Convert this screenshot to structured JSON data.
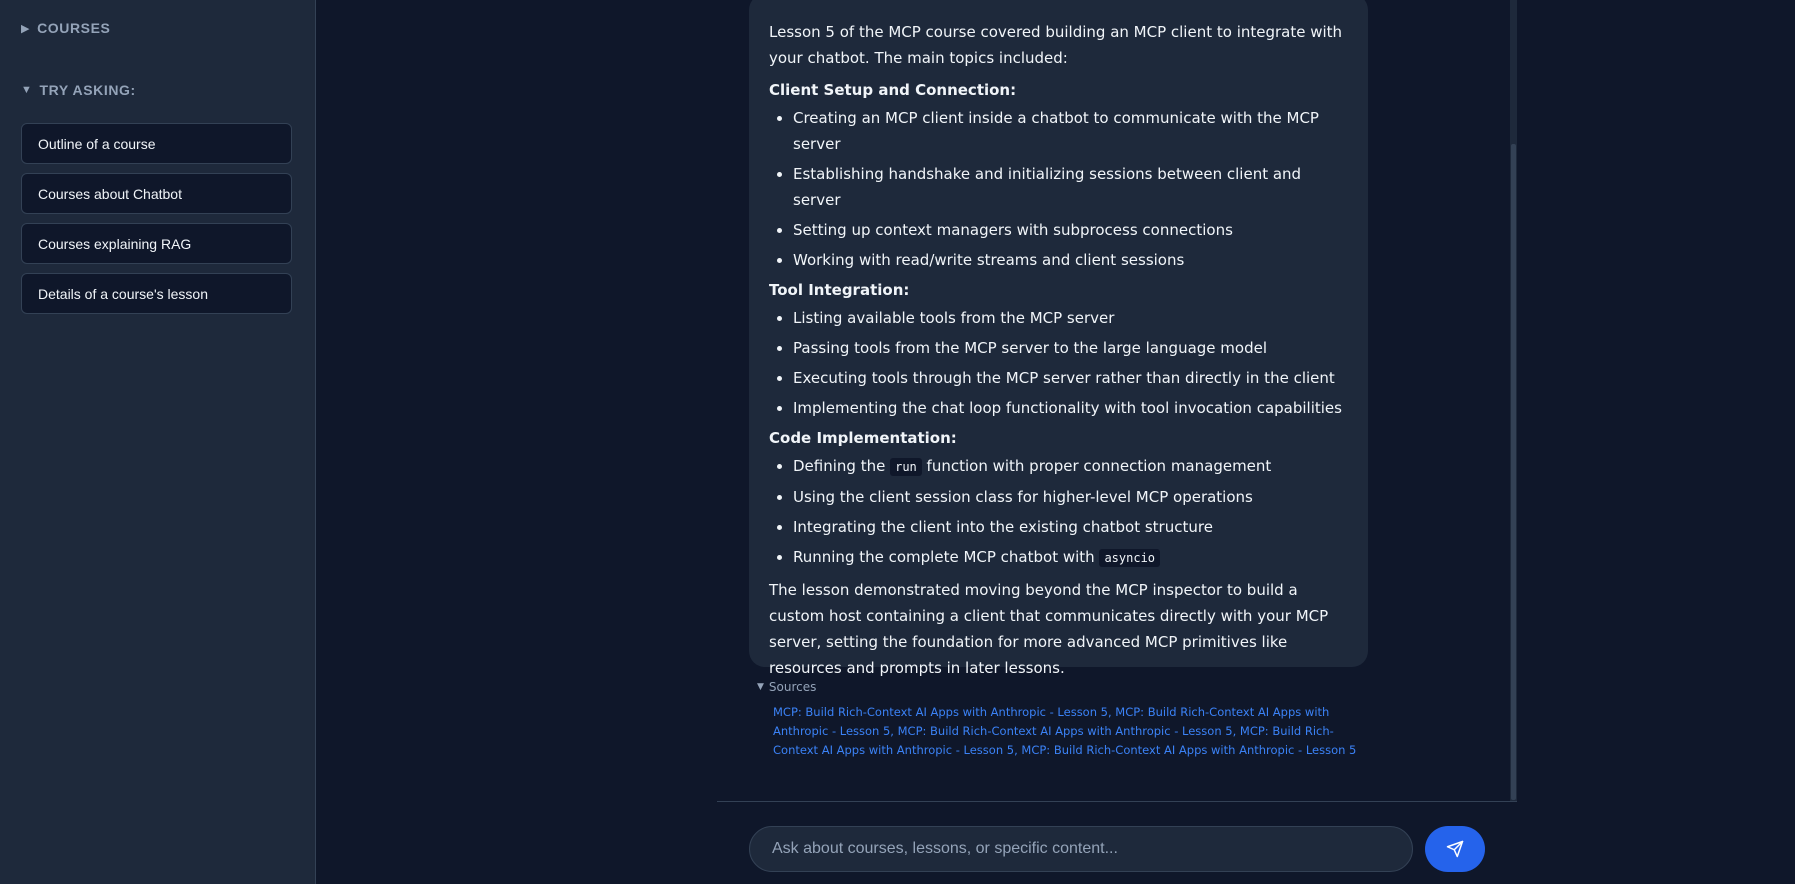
{
  "sidebar": {
    "courses_header": "COURSES",
    "courses_collapsed_glyph": "▶",
    "try_header": "TRY ASKING:",
    "try_expanded_glyph": "▼",
    "suggestions": [
      "Outline of a course",
      "Courses about Chatbot",
      "Courses explaining RAG",
      "Details of a course's lesson"
    ]
  },
  "message": {
    "intro": "Lesson 5 of the MCP course covered building an MCP client to integrate with your chatbot. The main topics included:",
    "sections": [
      {
        "heading": "Client Setup and Connection:",
        "items": [
          "Creating an MCP client inside a chatbot to communicate with the MCP server",
          "Establishing handshake and initializing sessions between client and server",
          "Setting up context managers with subprocess connections",
          "Working with read/write streams and client sessions"
        ]
      },
      {
        "heading": "Tool Integration:",
        "items": [
          "Listing available tools from the MCP server",
          "Passing tools from the MCP server to the large language model",
          "Executing tools through the MCP server rather than directly in the client",
          "Implementing the chat loop functionality with tool invocation capabilities"
        ]
      },
      {
        "heading": "Code Implementation:",
        "items_code": [
          {
            "before": "Defining the ",
            "code": "run",
            "after": " function with proper connection management"
          },
          {
            "before": "Using the client session class for higher-level MCP operations",
            "code": "",
            "after": ""
          },
          {
            "before": "Integrating the client into the existing chatbot structure",
            "code": "",
            "after": ""
          },
          {
            "before": "Running the complete MCP chatbot with ",
            "code": "asyncio",
            "after": ""
          }
        ]
      }
    ],
    "outro": "The lesson demonstrated moving beyond the MCP inspector to build a custom host containing a client that communicates directly with your MCP server, setting the foundation for more advanced MCP primitives like resources and prompts in later lessons."
  },
  "sources": {
    "label": "Sources",
    "glyph": "▼",
    "text": "MCP: Build Rich-Context AI Apps with Anthropic - Lesson 5, MCP: Build Rich-Context AI Apps with Anthropic - Lesson 5, MCP: Build Rich-Context AI Apps with Anthropic - Lesson 5, MCP: Build Rich-Context AI Apps with Anthropic - Lesson 5, MCP: Build Rich-Context AI Apps with Anthropic - Lesson 5"
  },
  "input": {
    "placeholder": "Ask about courses, lessons, or specific content...",
    "value": ""
  },
  "send_button": {
    "icon": "send-icon"
  },
  "colors": {
    "background": "#0f172a",
    "surface": "#1e293b",
    "border": "#334155",
    "text": "#f1f5f9",
    "muted": "#94a3b8",
    "accent": "#2563eb",
    "link": "#3b82f6"
  }
}
